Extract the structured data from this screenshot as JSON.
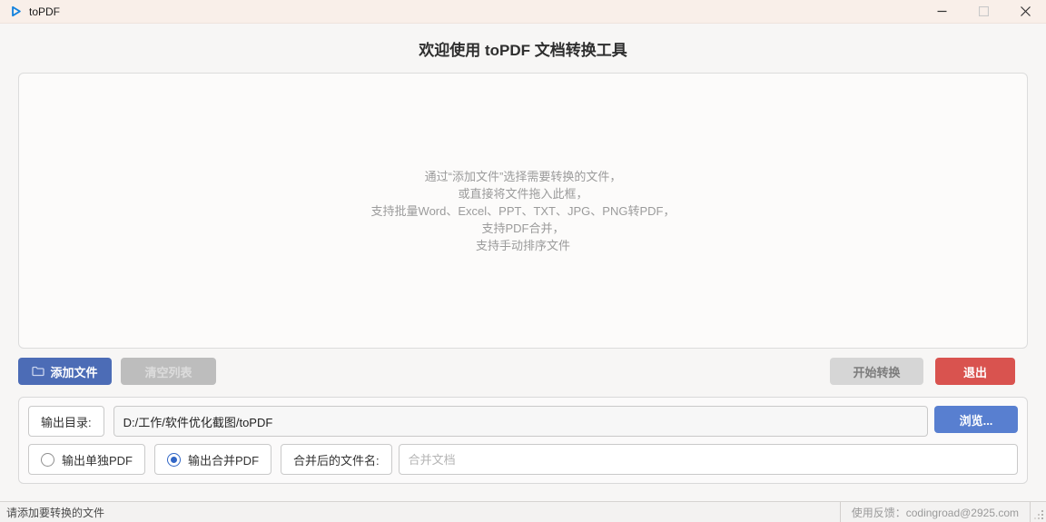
{
  "window": {
    "title": "toPDF",
    "controls": {
      "minimize_icon": "minimize",
      "maximize_icon": "maximize (disabled)",
      "close_icon": "close"
    }
  },
  "header": {
    "title": "欢迎使用 toPDF 文档转换工具"
  },
  "dropzone": {
    "lines": [
      "通过“添加文件”选择需要转换的文件，",
      "或直接将文件拖入此框，",
      "支持批量Word、Excel、PPT、TXT、JPG、PNG转PDF，",
      "支持PDF合并，",
      "支持手动排序文件"
    ]
  },
  "toolbar": {
    "add_files_label": "添加文件",
    "clear_list_label": "清空列表",
    "start_convert_label": "开始转换",
    "exit_label": "退出"
  },
  "output": {
    "dir_label": "输出目录:",
    "dir_value": "D:/工作/软件优化截图/toPDF",
    "browse_label": "浏览...",
    "radio_single_label": "输出单独PDF",
    "radio_single_checked": false,
    "radio_merge_label": "输出合并PDF",
    "radio_merge_checked": true,
    "merge_name_label": "合并后的文件名:",
    "merge_name_placeholder": "合并文档",
    "merge_name_value": ""
  },
  "statusbar": {
    "left": "请添加要转换的文件",
    "feedback": "使用反馈：codingroad@2925.com"
  },
  "colors": {
    "titlebar_bg": "#f9efe9",
    "window_bg": "#f7f6f5",
    "primary_blue": "#4c6cb6",
    "browse_blue": "#587fd0",
    "exit_red": "#d9534f",
    "disabled_gray": "#bdbdbd",
    "radio_blue": "#3166c6"
  }
}
